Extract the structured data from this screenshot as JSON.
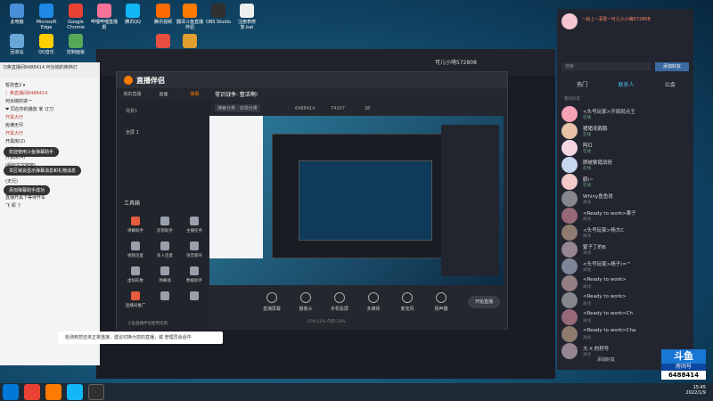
{
  "desktop": {
    "icons": [
      {
        "label": "此电脑",
        "color": "#4a90d9"
      },
      {
        "label": "Microsoft Edge",
        "color": "#1e88e5"
      },
      {
        "label": "Google Chrome",
        "color": "#e94235"
      },
      {
        "label": "哔哩哔哩直播姬",
        "color": "#fb7299"
      },
      {
        "label": "腾讯QQ",
        "color": "#12b7f5"
      },
      {
        "label": "腾讯视频",
        "color": "#ff6a00"
      },
      {
        "label": "翻译斗鱼直播伴侣",
        "color": "#ff7a00"
      },
      {
        "label": "OBS Studio",
        "color": "#303030"
      },
      {
        "label": "注册表修复.bat",
        "color": "#eeeeee"
      },
      {
        "label": "回收站",
        "color": "#6aa6d6"
      },
      {
        "label": "QQ音乐",
        "color": "#ffcf00"
      },
      {
        "label": "控制面板",
        "color": "#58a85a"
      },
      {
        "label": "",
        "color": "#e84e3f"
      },
      {
        "label": "",
        "color": "#e0a030"
      }
    ]
  },
  "chat": {
    "title": "D焦直播间6488414 何汝婉的焦档灯",
    "header_right": "6488414",
    "rows": [
      "暂改查2 ▾",
      "冫焦直播间6488414",
      "何汝婉的讲一",
      "❤ 同在你的播放 家 订刀",
      "开黑大厅",
      "房满无尽",
      "开黑大厅",
      "开黑房(2)",
      "开黑房(3)",
      "开黑房(4)",
      "(组织宝宝窗窗)",
      "(滋吧)",
      "(天兄)",
      "监   妃   公   厦   (声耳前一",
      "直播开黑下等待开车",
      "飞  闻 丫"
    ],
    "bubbles": [
      "欢迎使用斗鱼弹幕助手",
      "本区域会显示弹幕消息和礼物消息",
      "添加弹幕助手成功"
    ]
  },
  "main_window": {
    "title": "可儿小萌572808",
    "tabs": [
      "推荐",
      "分类",
      "直播"
    ]
  },
  "obs": {
    "app_title": "直播伴侣",
    "tabs": [
      "我的直播",
      "画面",
      "弹幕"
    ],
    "scene_label": "场景1",
    "scene_item": "全屏 1",
    "toolbox_title": "工具箱",
    "tools": [
      {
        "label": "弹幕助手",
        "color": "#e35c3c"
      },
      {
        "label": "房管助手",
        "color": "#9aa0ab"
      },
      {
        "label": "主播任务",
        "color": "#9aa0ab"
      },
      {
        "label": "视频连麦",
        "color": "#9aa0ab"
      },
      {
        "label": "多人连麦",
        "color": "#9aa0ab"
      },
      {
        "label": "语音聊天",
        "color": "#9aa0ab"
      },
      {
        "label": "虚拟形象",
        "color": "#9aa0ab"
      },
      {
        "label": "弹幕墙",
        "color": "#9aa0ab"
      },
      {
        "label": "数据助手",
        "color": "#9aa0ab"
      },
      {
        "label": "直播间推广",
        "color": "#e35c3c"
      },
      {
        "label": "",
        "color": "#9aa0ab"
      },
      {
        "label": "",
        "color": "#9aa0ab"
      }
    ],
    "footer_note": "斗鱼直播伴侣使用指南",
    "stream_title": "常识战争: 整活啊!",
    "room_id": "6488414",
    "viewers": "74107",
    "fans": "38",
    "category_btn": "搜索分类 · 实现分类",
    "bottom_buttons": [
      "直播屏幕",
      "摄像头",
      "手机投屏",
      "多媒体",
      "麦克风",
      "扬声器"
    ],
    "start_button": "开始直播",
    "stats": "CPU:52%  内存:33%"
  },
  "right_panel": {
    "user_name": "~灿上~深爱~可儿小小萌572808",
    "tabs": [
      "热门",
      "联系人",
      "公会"
    ],
    "search_placeholder": "搜索",
    "add_button": "添加好友",
    "section_label": "我的好友",
    "items": [
      {
        "name": "<头号玩家>开局就点王",
        "status": "在线"
      },
      {
        "name": "猪猪宠鹅鹅",
        "status": "在线"
      },
      {
        "name": "阿红",
        "status": "在线"
      },
      {
        "name": "顾被紫霞战役",
        "status": "在线"
      },
      {
        "name": "鹤\\~",
        "status": "在线"
      },
      {
        "name": "Whiny鱼鱼说",
        "status": "离线"
      },
      {
        "name": "<Ready to work>果子",
        "status": "离线"
      },
      {
        "name": "<头号玩家>杨大C",
        "status": "离线"
      },
      {
        "name": "繁子丁的B",
        "status": "离线"
      },
      {
        "name": "<头号玩家>杨子(=^",
        "status": "离线"
      },
      {
        "name": "<Ready to work>",
        "status": "离线"
      },
      {
        "name": "<Ready to work>",
        "status": "离线"
      },
      {
        "name": "<Ready to work>Ch",
        "status": "离线"
      },
      {
        "name": "<Ready to work>Cha",
        "status": "离线"
      },
      {
        "name": "大 X 的称号",
        "status": "离线"
      }
    ],
    "footer_button": "添加好友"
  },
  "searchbar": {
    "text": "检测到您还未正常连接，建议切换为您的直播，或 管理员会话中"
  },
  "overlay": {
    "brand": "斗鱼",
    "room_label": "房间号",
    "room_number": "6488414"
  },
  "taskbar": {
    "time": "15:45",
    "date": "2022/1/9"
  }
}
